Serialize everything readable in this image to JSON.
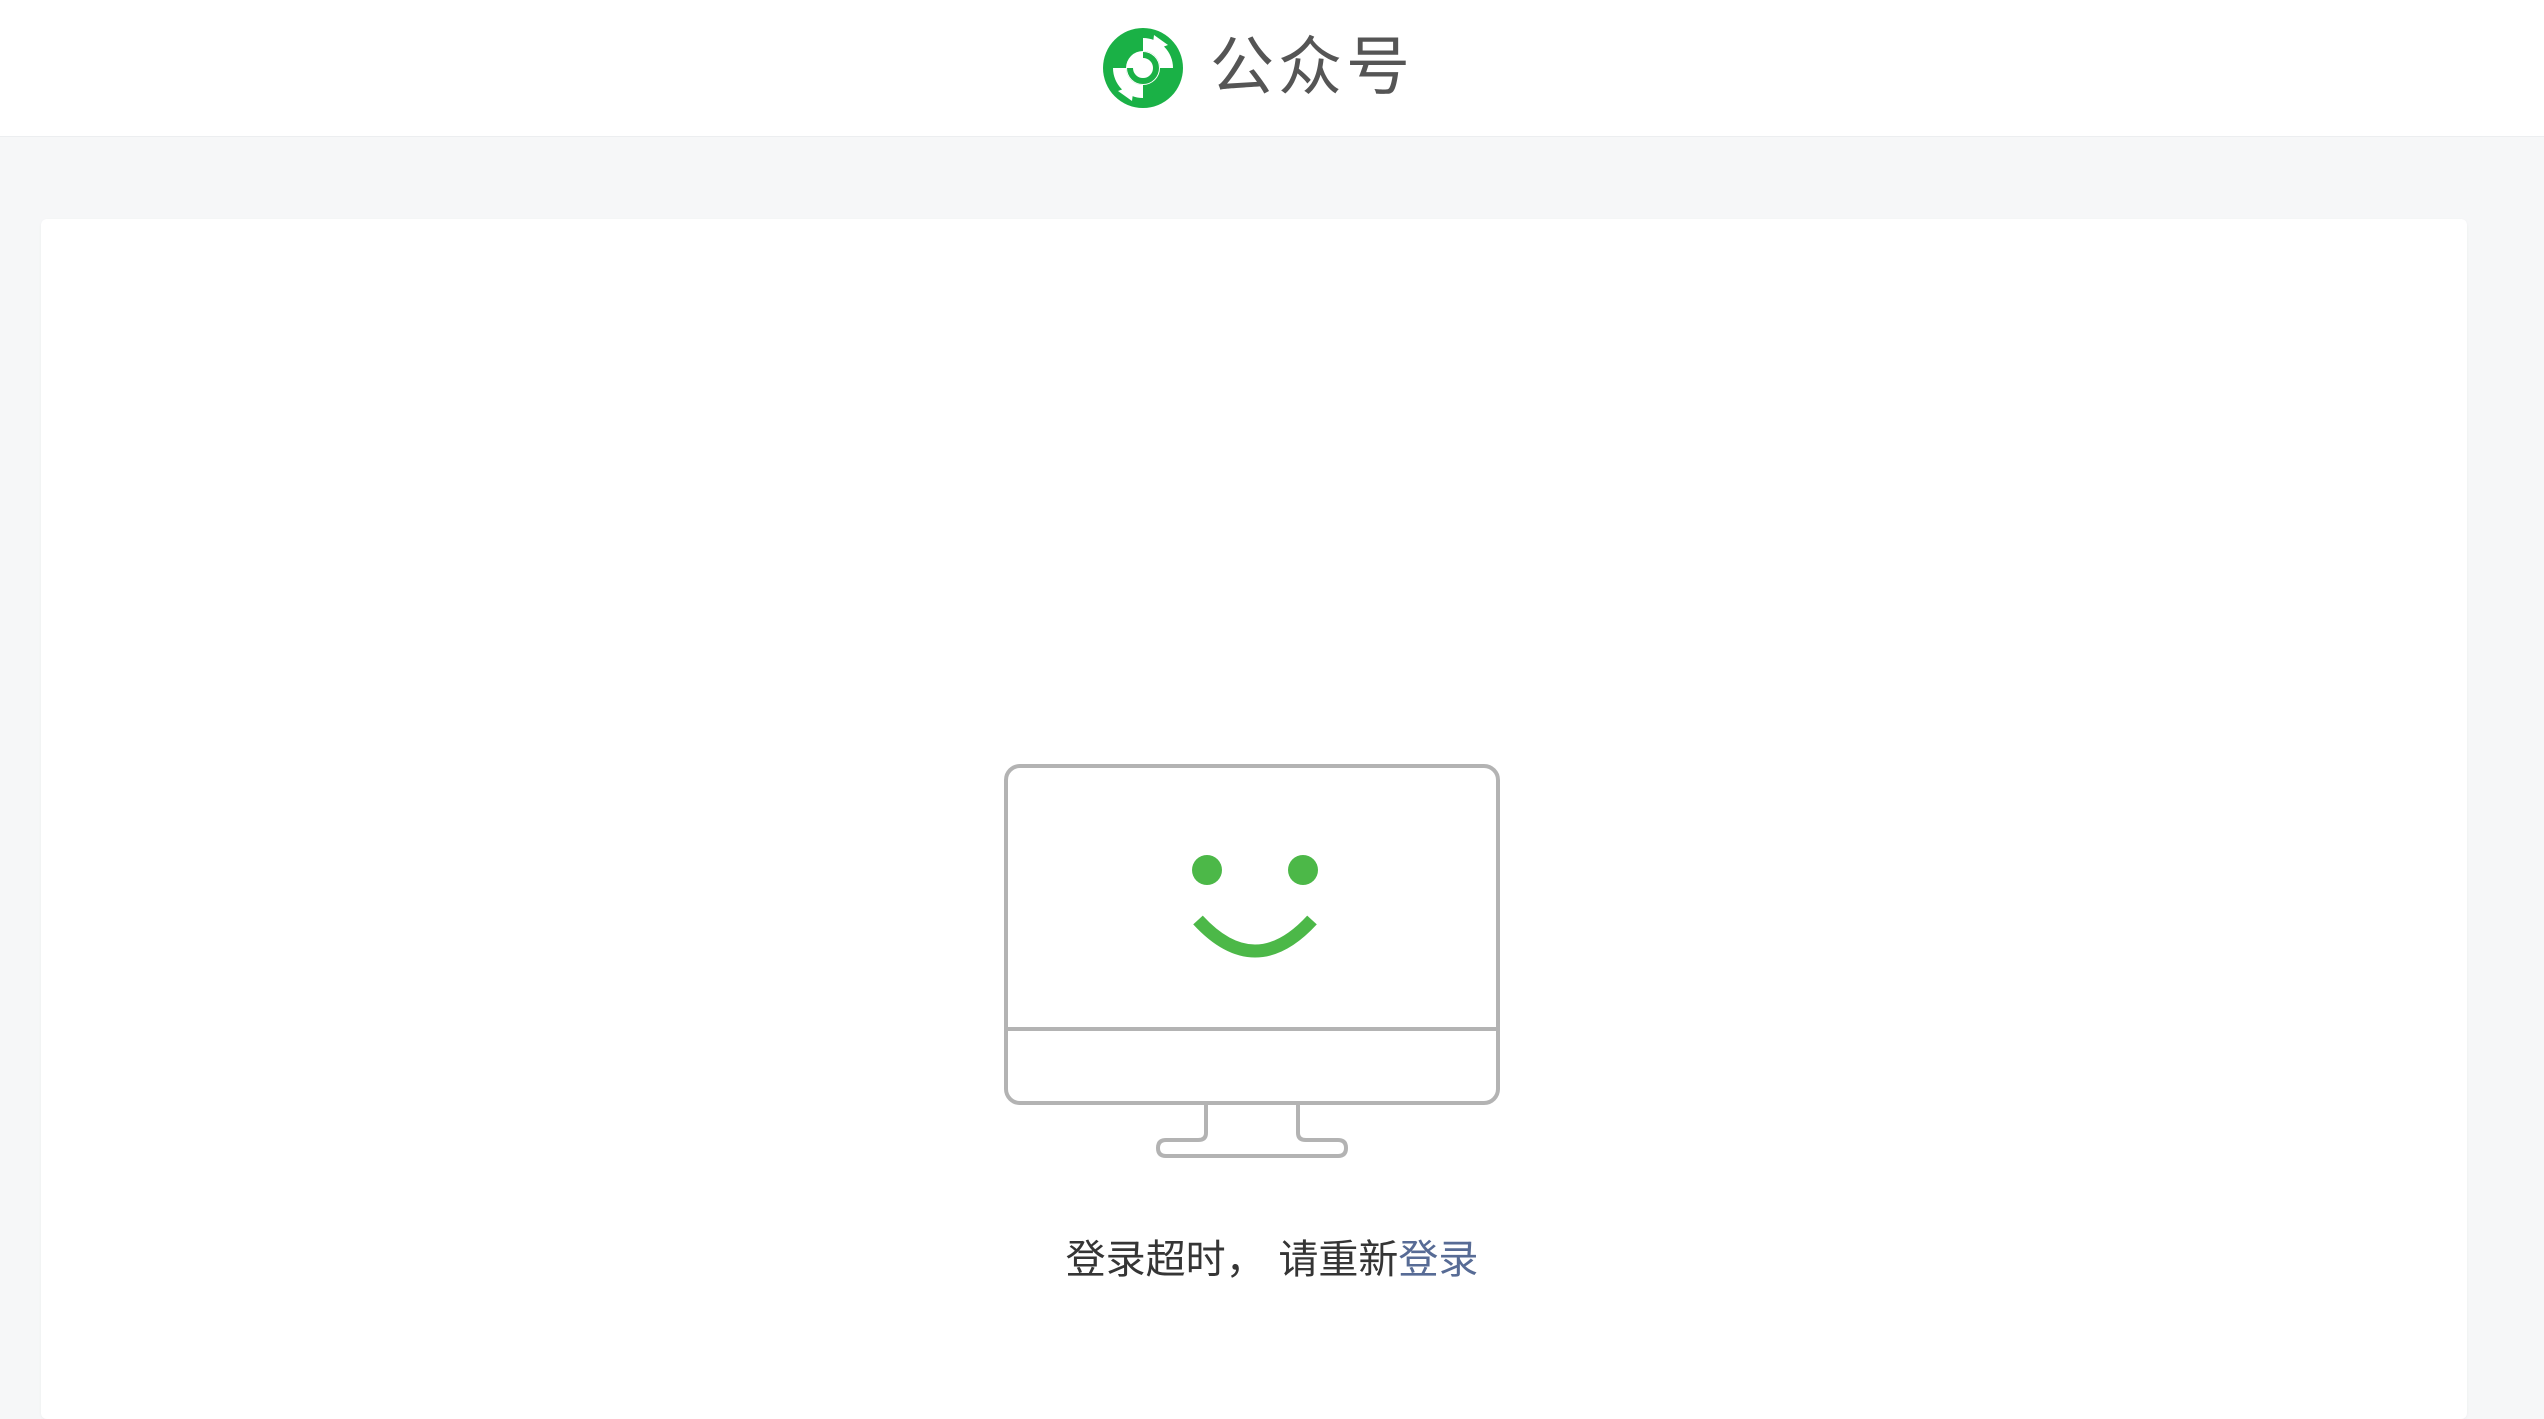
{
  "header": {
    "brand_name": "公众号",
    "logo_icon": "wechat-official-accounts-logo-icon",
    "logo_color": "#1aad19"
  },
  "main": {
    "illustration_icon": "monitor-smile-icon",
    "accent_color": "#4cb848",
    "message_prefix": "登录超时， 请重新",
    "login_link_label": "登录",
    "link_color": "#576b95"
  }
}
